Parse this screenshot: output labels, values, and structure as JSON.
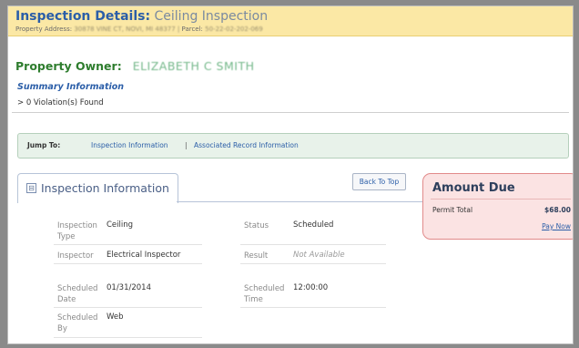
{
  "header": {
    "title_bold": "Inspection Details:",
    "title_rest": "Ceiling Inspection",
    "address_label": "Property Address:",
    "address_value": "30878 VINE CT, NOVI, MI 48377",
    "parcel_label": "Parcel:",
    "parcel_value": "50-22-02-202-069"
  },
  "owner": {
    "label": "Property Owner:",
    "name": "ELIZABETH C SMITH"
  },
  "summary": {
    "title": "Summary Information",
    "violations": "> 0 Violation(s) Found"
  },
  "jump": {
    "label": "Jump To:",
    "link1": "Inspection Information",
    "separator": "|",
    "link2": "Associated Record Information"
  },
  "tab": {
    "icon": "⊟",
    "label": "Inspection Information"
  },
  "back_button": "Back To Top",
  "fields": {
    "inspection_type_label": "Inspection Type",
    "inspection_type_value": "Ceiling",
    "status_label": "Status",
    "status_value": "Scheduled",
    "inspector_label": "Inspector",
    "inspector_value": "Electrical Inspector",
    "result_label": "Result",
    "result_value": "Not Available",
    "scheduled_date_label": "Scheduled Date",
    "scheduled_date_value": "01/31/2014",
    "scheduled_time_label": "Scheduled Time",
    "scheduled_time_value": "12:00:00",
    "scheduled_by_label": "Scheduled By",
    "scheduled_by_value": "Web"
  },
  "amount_due": {
    "title": "Amount Due",
    "permit_label": "Permit Total",
    "permit_value": "$68.00",
    "pay_now": "Pay Now"
  }
}
